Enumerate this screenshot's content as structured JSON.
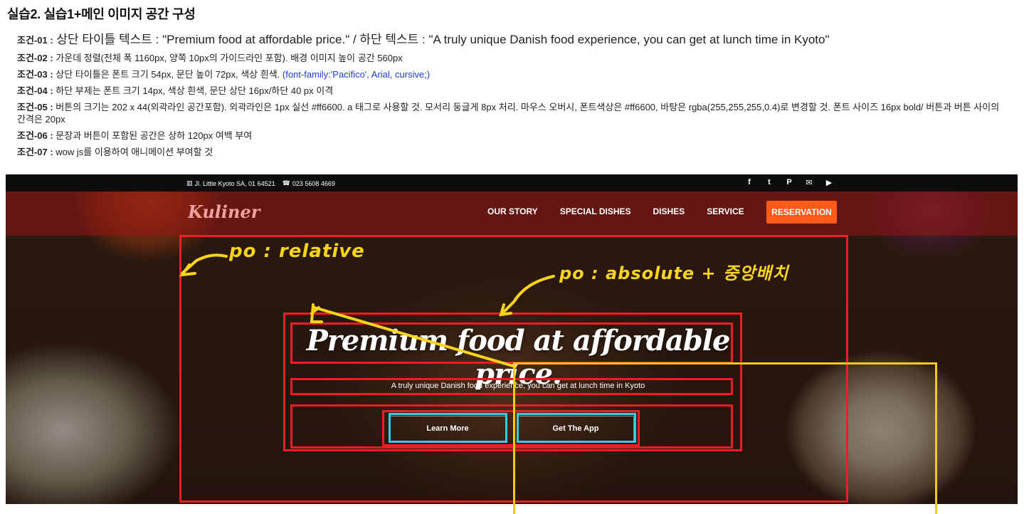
{
  "doc": {
    "title": "실습2. 실습1+메인 이미지 공간 구성"
  },
  "conditions": [
    {
      "key": "조건-01 :",
      "text": " 상단 타이틀 텍스트 : \"Premium food at affordable price.\" / 하단 텍스트 : \"A truly unique Danish food experience, you can get at lunch time in Kyoto\""
    },
    {
      "key": "조건-02 :",
      "text": " 가운데 정렬(전체 폭 1160px, 양쪽 10px의 가이드라인 포함). 배경 이미지 높이 공간 560px"
    },
    {
      "key": "조건-03 :",
      "text": " 상단 타이틀은 폰트 크기 54px, 문단 높이 72px, 색상 흰색. ",
      "note": "(font-family:'Pacifico', Arial, cursive;)"
    },
    {
      "key": "조건-04 :",
      "text": " 하단 부제는 폰트 크기 14px, 색상 흰색, 문단 상단 16px/하단 40 px 이격"
    },
    {
      "key": "조건-05 :",
      "text": " 버튼의 크기는 202 x 44(외곽라인 공간포함). 외곽라인은 1px 실선 #ff6600. a 태그로 사용할 것. 모서리 둥글게 8px 처리. 마우스 오버시, 폰트색상은 #ff6600, 바탕은 rgba(255,255,255,0.4)로 변경할 것. 폰트 사이즈 16px bold/ 버튼과 버튼 사이의 간격은 20px"
    },
    {
      "key": "조건-06 :",
      "text": " 문장과 버튼이 포함된 공간은 상하 120px 여백 부여"
    },
    {
      "key": "조건-07 :",
      "text": " wow js를 이용하여 애니메이션 부여할 것"
    }
  ],
  "site": {
    "address": "Jl. Little Kyoto SA, 01 64521",
    "phone": "023 5608 4669",
    "logo": "Kuliner",
    "menu": [
      "OUR STORY",
      "SPECIAL DISHES",
      "DISHES",
      "SERVICE"
    ],
    "reservation": "RESERVATION",
    "headline": "Premium food at affordable price.",
    "subline": "A truly unique Danish food experience, you can get at lunch time in Kyoto",
    "buttons": {
      "learn": "Learn More",
      "app": "Get The App"
    }
  },
  "annotations": {
    "relative": "po : relative",
    "absolute": "po : absolute + 중앙배치"
  },
  "colors": {
    "annotation_red": "#ee1c25",
    "annotation_yellow": "#f4c91f",
    "annotation_cyan": "#38c8e8",
    "reserve": "#ff5a1a"
  }
}
